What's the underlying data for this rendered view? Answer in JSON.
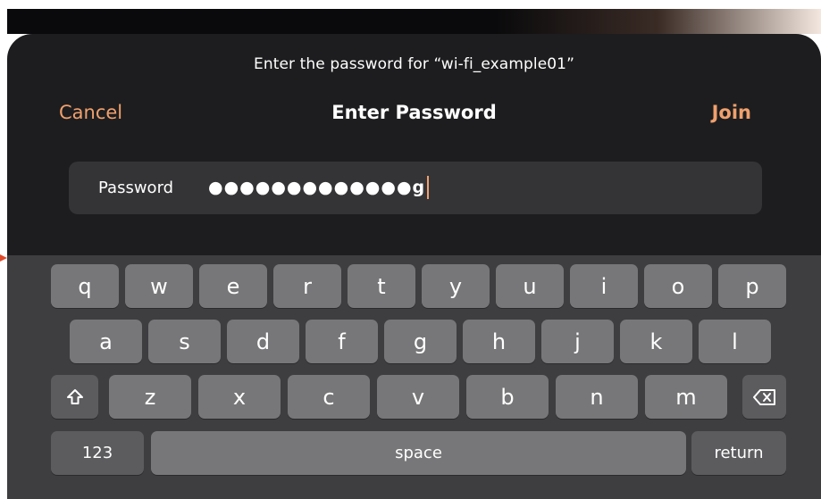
{
  "dialog": {
    "prompt": "Enter the password for “wi-fi_example01”",
    "cancel_label": "Cancel",
    "title": "Enter Password",
    "join_label": "Join",
    "password_label": "Password",
    "password_value": "●●●●●●●●●●●●●g"
  },
  "keyboard": {
    "row1": [
      "q",
      "w",
      "e",
      "r",
      "t",
      "y",
      "u",
      "i",
      "o",
      "p"
    ],
    "row2": [
      "a",
      "s",
      "d",
      "f",
      "g",
      "h",
      "j",
      "k",
      "l"
    ],
    "row3": [
      "z",
      "x",
      "c",
      "v",
      "b",
      "n",
      "m"
    ],
    "numbers_label": "123",
    "space_label": "space",
    "return_label": "return",
    "shift_icon": "shift-arrow-up-icon",
    "delete_icon": "backspace-icon"
  },
  "colors": {
    "accent": "#f0a06d",
    "dialog_bg": "#1d1d1f",
    "field_bg": "#343437",
    "keyboard_bg": "#3e3e41",
    "key_bg": "#777779",
    "function_key_bg": "#5c5c5f"
  }
}
